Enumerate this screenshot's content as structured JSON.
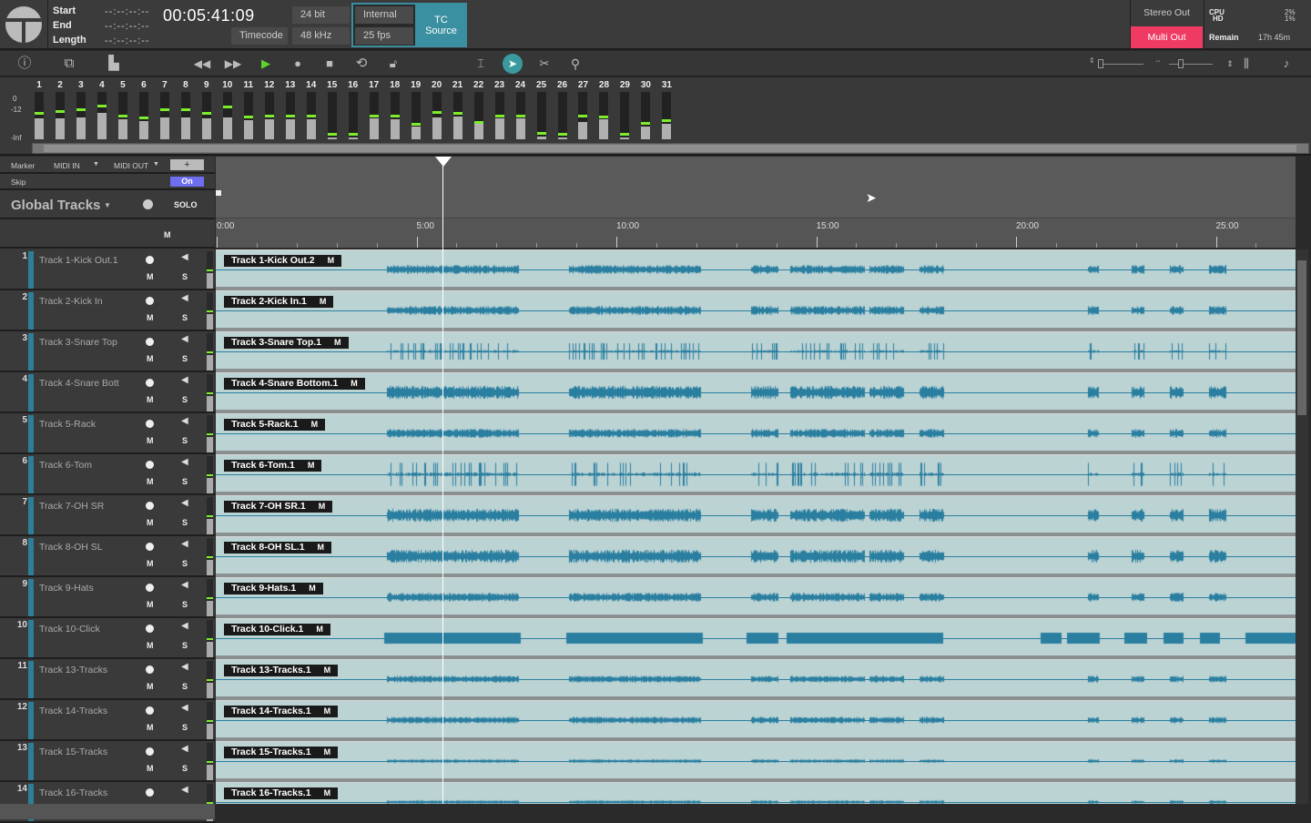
{
  "header": {
    "start_label": "Start",
    "end_label": "End",
    "length_label": "Length",
    "start_value": "--:--:--:--",
    "end_value": "--:--:--:--",
    "length_value": "--:--:--:--",
    "timecode": "00:05:41:09",
    "timecode_mode": "Timecode",
    "bit_depth": "24 bit",
    "sample_rate": "48 kHz",
    "sync_source": "Internal",
    "frame_rate": "25 fps",
    "tc_source": "TC\nSource",
    "stereo_out": "Stereo Out",
    "multi_out": "Multi Out",
    "cpu_label": "CPU",
    "hd_label": "HD",
    "cpu_value": "2%",
    "hd_value": "1%",
    "remain_label": "Remain",
    "remain_value": "17h 45m"
  },
  "colors": {
    "accent_teal": "#3a8fa0",
    "multi_out": "#ef3b63",
    "skip_on": "#6e6ef0",
    "lane": "#bcd3d4",
    "waveform": "#2a7fa0",
    "meter_peak": "#7cec2c"
  },
  "toolbar": {
    "icons": [
      "info-icon",
      "mixer-icon",
      "meters-icon",
      "rewind-icon",
      "fast-forward-icon",
      "play-icon",
      "record-icon",
      "stop-icon",
      "loop-icon",
      "lock-icon",
      "range-tool-icon",
      "pointer-tool-icon",
      "split-tool-icon",
      "zoom-tool-icon"
    ]
  },
  "meters": {
    "scale": [
      "0",
      "-12",
      "-Inf"
    ],
    "levels": [
      0.45,
      0.45,
      0.47,
      0.55,
      0.42,
      0.38,
      0.47,
      0.47,
      0.45,
      0.47,
      0.4,
      0.43,
      0.43,
      0.42,
      0.04,
      0.04,
      0.45,
      0.42,
      0.26,
      0.47,
      0.49,
      0.32,
      0.45,
      0.45,
      0.06,
      0.04,
      0.36,
      0.42,
      0.04,
      0.26,
      0.32
    ],
    "peaks": [
      0.52,
      0.55,
      0.59,
      0.67,
      0.46,
      0.42,
      0.59,
      0.59,
      0.52,
      0.65,
      0.44,
      0.46,
      0.46,
      0.46,
      0.08,
      0.08,
      0.47,
      0.47,
      0.28,
      0.54,
      0.52,
      0.33,
      0.47,
      0.47,
      0.09,
      0.07,
      0.47,
      0.45,
      0.07,
      0.3,
      0.36
    ]
  },
  "left_panel": {
    "marker": "Marker",
    "midi_in": "MIDI IN",
    "midi_out": "MIDI OUT",
    "add": "+",
    "skip": "Skip",
    "skip_state": "On",
    "global_tracks": "Global Tracks",
    "solo": "SOLO",
    "m": "M"
  },
  "ruler": {
    "ticks": [
      "0:00",
      "5:00",
      "10:00",
      "15:00",
      "20:00",
      "25:00"
    ],
    "playhead": "05:41"
  },
  "track_labels": {
    "mute": "M",
    "solo": "S",
    "region_mute": "M"
  },
  "tracks": [
    {
      "num": "1",
      "name": "Track 1-Kick Out.1",
      "region": "Track 1-Kick Out.2"
    },
    {
      "num": "2",
      "name": "Track 2-Kick In",
      "region": "Track 2-Kick In.1"
    },
    {
      "num": "3",
      "name": "Track 3-Snare Top",
      "region": "Track 3-Snare Top.1"
    },
    {
      "num": "4",
      "name": "Track 4-Snare Bott",
      "region": "Track 4-Snare Bottom.1"
    },
    {
      "num": "5",
      "name": "Track 5-Rack",
      "region": "Track 5-Rack.1"
    },
    {
      "num": "6",
      "name": "Track 6-Tom",
      "region": "Track 6-Tom.1"
    },
    {
      "num": "7",
      "name": "Track 7-OH SR",
      "region": "Track 7-OH SR.1"
    },
    {
      "num": "8",
      "name": "Track 8-OH SL",
      "region": "Track 8-OH SL.1"
    },
    {
      "num": "9",
      "name": "Track 9-Hats",
      "region": "Track 9-Hats.1"
    },
    {
      "num": "10",
      "name": "Track 10-Click",
      "region": "Track 10-Click.1"
    },
    {
      "num": "11",
      "name": "Track 13-Tracks",
      "region": "Track 13-Tracks.1"
    },
    {
      "num": "12",
      "name": "Track 14-Tracks",
      "region": "Track 14-Tracks.1"
    },
    {
      "num": "13",
      "name": "Track 15-Tracks",
      "region": "Track 15-Tracks.1"
    },
    {
      "num": "14",
      "name": "Track 16-Tracks",
      "region": "Track 16-Tracks.1"
    }
  ]
}
